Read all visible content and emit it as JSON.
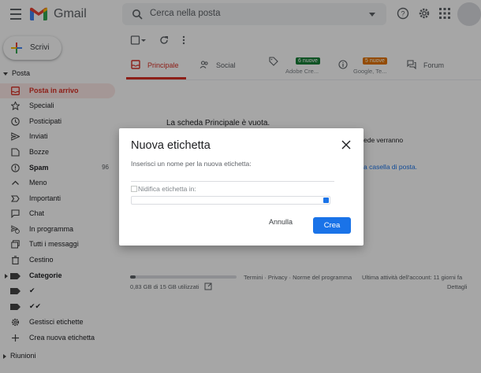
{
  "header": {
    "app_name": "Gmail",
    "search_placeholder": "Cerca nella posta"
  },
  "sidebar": {
    "compose_label": "Scrivi",
    "section_mail": "Posta",
    "items": [
      {
        "label": "Posta in arrivo",
        "icon": "inbox-icon",
        "active": true
      },
      {
        "label": "Speciali",
        "icon": "star-icon"
      },
      {
        "label": "Posticipati",
        "icon": "clock-icon"
      },
      {
        "label": "Inviati",
        "icon": "send-icon"
      },
      {
        "label": "Bozze",
        "icon": "draft-icon"
      },
      {
        "label": "Spam",
        "icon": "spam-icon",
        "count": "96"
      },
      {
        "label": "Meno",
        "icon": "chevron-up-icon"
      },
      {
        "label": "Importanti",
        "icon": "important-icon"
      },
      {
        "label": "Chat",
        "icon": "chat-icon"
      },
      {
        "label": "In programma",
        "icon": "scheduled-icon"
      },
      {
        "label": "Tutti i messaggi",
        "icon": "all-mail-icon"
      },
      {
        "label": "Cestino",
        "icon": "trash-icon"
      },
      {
        "label": "Categorie",
        "icon": "label-icon"
      },
      {
        "label": "✔",
        "icon": "label-icon"
      },
      {
        "label": "✔✔",
        "icon": "label-icon"
      },
      {
        "label": "Gestisci etichette",
        "icon": "gear-icon"
      },
      {
        "label": "Crea nuova etichetta",
        "icon": "plus-icon"
      }
    ],
    "section_meetings": "Riunioni"
  },
  "tabs": [
    {
      "label": "Principale",
      "active": true
    },
    {
      "label": "Social"
    },
    {
      "badge": "6 nuove",
      "badge_color": "#188038",
      "sub": "Adobe Cre..."
    },
    {
      "badge": "5 nuove",
      "badge_color": "#e37400",
      "sub": "Google, Te..."
    },
    {
      "label": "Forum"
    }
  ],
  "main": {
    "empty_message": "La scheda Principale è vuota.",
    "bg_fragment_1": "ede verranno",
    "bg_fragment_2": "a casella di posta."
  },
  "footer": {
    "storage": "0,83 GB di 15 GB utilizzati",
    "storage_fraction": 0.055,
    "links": "Termini · Privacy · Norme del programma",
    "activity": "Ultima attività dell'account: 11 giorni fa",
    "details": "Dettagli"
  },
  "dialog": {
    "title": "Nuova etichetta",
    "prompt": "Inserisci un nome per la nuova etichetta:",
    "input_value": "",
    "nest_label": "Nidifica etichetta in:",
    "cancel_label": "Annulla",
    "create_label": "Crea"
  },
  "colors": {
    "accent_red": "#d93025",
    "primary_blue": "#1a73e8"
  }
}
